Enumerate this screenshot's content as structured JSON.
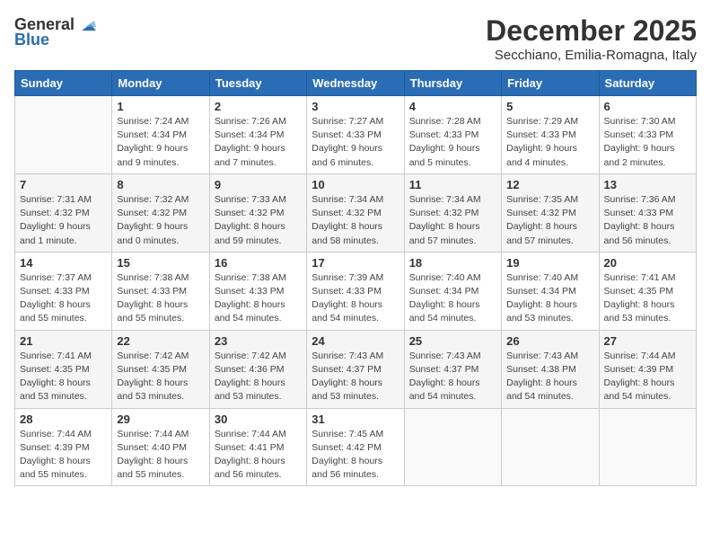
{
  "logo": {
    "general": "General",
    "blue": "Blue"
  },
  "header": {
    "month_year": "December 2025",
    "location": "Secchiano, Emilia-Romagna, Italy"
  },
  "weekdays": [
    "Sunday",
    "Monday",
    "Tuesday",
    "Wednesday",
    "Thursday",
    "Friday",
    "Saturday"
  ],
  "weeks": [
    [
      {
        "day": "",
        "info": ""
      },
      {
        "day": "1",
        "info": "Sunrise: 7:24 AM\nSunset: 4:34 PM\nDaylight: 9 hours\nand 9 minutes."
      },
      {
        "day": "2",
        "info": "Sunrise: 7:26 AM\nSunset: 4:34 PM\nDaylight: 9 hours\nand 7 minutes."
      },
      {
        "day": "3",
        "info": "Sunrise: 7:27 AM\nSunset: 4:33 PM\nDaylight: 9 hours\nand 6 minutes."
      },
      {
        "day": "4",
        "info": "Sunrise: 7:28 AM\nSunset: 4:33 PM\nDaylight: 9 hours\nand 5 minutes."
      },
      {
        "day": "5",
        "info": "Sunrise: 7:29 AM\nSunset: 4:33 PM\nDaylight: 9 hours\nand 4 minutes."
      },
      {
        "day": "6",
        "info": "Sunrise: 7:30 AM\nSunset: 4:33 PM\nDaylight: 9 hours\nand 2 minutes."
      }
    ],
    [
      {
        "day": "7",
        "info": "Sunrise: 7:31 AM\nSunset: 4:32 PM\nDaylight: 9 hours\nand 1 minute."
      },
      {
        "day": "8",
        "info": "Sunrise: 7:32 AM\nSunset: 4:32 PM\nDaylight: 9 hours\nand 0 minutes."
      },
      {
        "day": "9",
        "info": "Sunrise: 7:33 AM\nSunset: 4:32 PM\nDaylight: 8 hours\nand 59 minutes."
      },
      {
        "day": "10",
        "info": "Sunrise: 7:34 AM\nSunset: 4:32 PM\nDaylight: 8 hours\nand 58 minutes."
      },
      {
        "day": "11",
        "info": "Sunrise: 7:34 AM\nSunset: 4:32 PM\nDaylight: 8 hours\nand 57 minutes."
      },
      {
        "day": "12",
        "info": "Sunrise: 7:35 AM\nSunset: 4:32 PM\nDaylight: 8 hours\nand 57 minutes."
      },
      {
        "day": "13",
        "info": "Sunrise: 7:36 AM\nSunset: 4:33 PM\nDaylight: 8 hours\nand 56 minutes."
      }
    ],
    [
      {
        "day": "14",
        "info": "Sunrise: 7:37 AM\nSunset: 4:33 PM\nDaylight: 8 hours\nand 55 minutes."
      },
      {
        "day": "15",
        "info": "Sunrise: 7:38 AM\nSunset: 4:33 PM\nDaylight: 8 hours\nand 55 minutes."
      },
      {
        "day": "16",
        "info": "Sunrise: 7:38 AM\nSunset: 4:33 PM\nDaylight: 8 hours\nand 54 minutes."
      },
      {
        "day": "17",
        "info": "Sunrise: 7:39 AM\nSunset: 4:33 PM\nDaylight: 8 hours\nand 54 minutes."
      },
      {
        "day": "18",
        "info": "Sunrise: 7:40 AM\nSunset: 4:34 PM\nDaylight: 8 hours\nand 54 minutes."
      },
      {
        "day": "19",
        "info": "Sunrise: 7:40 AM\nSunset: 4:34 PM\nDaylight: 8 hours\nand 53 minutes."
      },
      {
        "day": "20",
        "info": "Sunrise: 7:41 AM\nSunset: 4:35 PM\nDaylight: 8 hours\nand 53 minutes."
      }
    ],
    [
      {
        "day": "21",
        "info": "Sunrise: 7:41 AM\nSunset: 4:35 PM\nDaylight: 8 hours\nand 53 minutes."
      },
      {
        "day": "22",
        "info": "Sunrise: 7:42 AM\nSunset: 4:35 PM\nDaylight: 8 hours\nand 53 minutes."
      },
      {
        "day": "23",
        "info": "Sunrise: 7:42 AM\nSunset: 4:36 PM\nDaylight: 8 hours\nand 53 minutes."
      },
      {
        "day": "24",
        "info": "Sunrise: 7:43 AM\nSunset: 4:37 PM\nDaylight: 8 hours\nand 53 minutes."
      },
      {
        "day": "25",
        "info": "Sunrise: 7:43 AM\nSunset: 4:37 PM\nDaylight: 8 hours\nand 54 minutes."
      },
      {
        "day": "26",
        "info": "Sunrise: 7:43 AM\nSunset: 4:38 PM\nDaylight: 8 hours\nand 54 minutes."
      },
      {
        "day": "27",
        "info": "Sunrise: 7:44 AM\nSunset: 4:39 PM\nDaylight: 8 hours\nand 54 minutes."
      }
    ],
    [
      {
        "day": "28",
        "info": "Sunrise: 7:44 AM\nSunset: 4:39 PM\nDaylight: 8 hours\nand 55 minutes."
      },
      {
        "day": "29",
        "info": "Sunrise: 7:44 AM\nSunset: 4:40 PM\nDaylight: 8 hours\nand 55 minutes."
      },
      {
        "day": "30",
        "info": "Sunrise: 7:44 AM\nSunset: 4:41 PM\nDaylight: 8 hours\nand 56 minutes."
      },
      {
        "day": "31",
        "info": "Sunrise: 7:45 AM\nSunset: 4:42 PM\nDaylight: 8 hours\nand 56 minutes."
      },
      {
        "day": "",
        "info": ""
      },
      {
        "day": "",
        "info": ""
      },
      {
        "day": "",
        "info": ""
      }
    ]
  ]
}
